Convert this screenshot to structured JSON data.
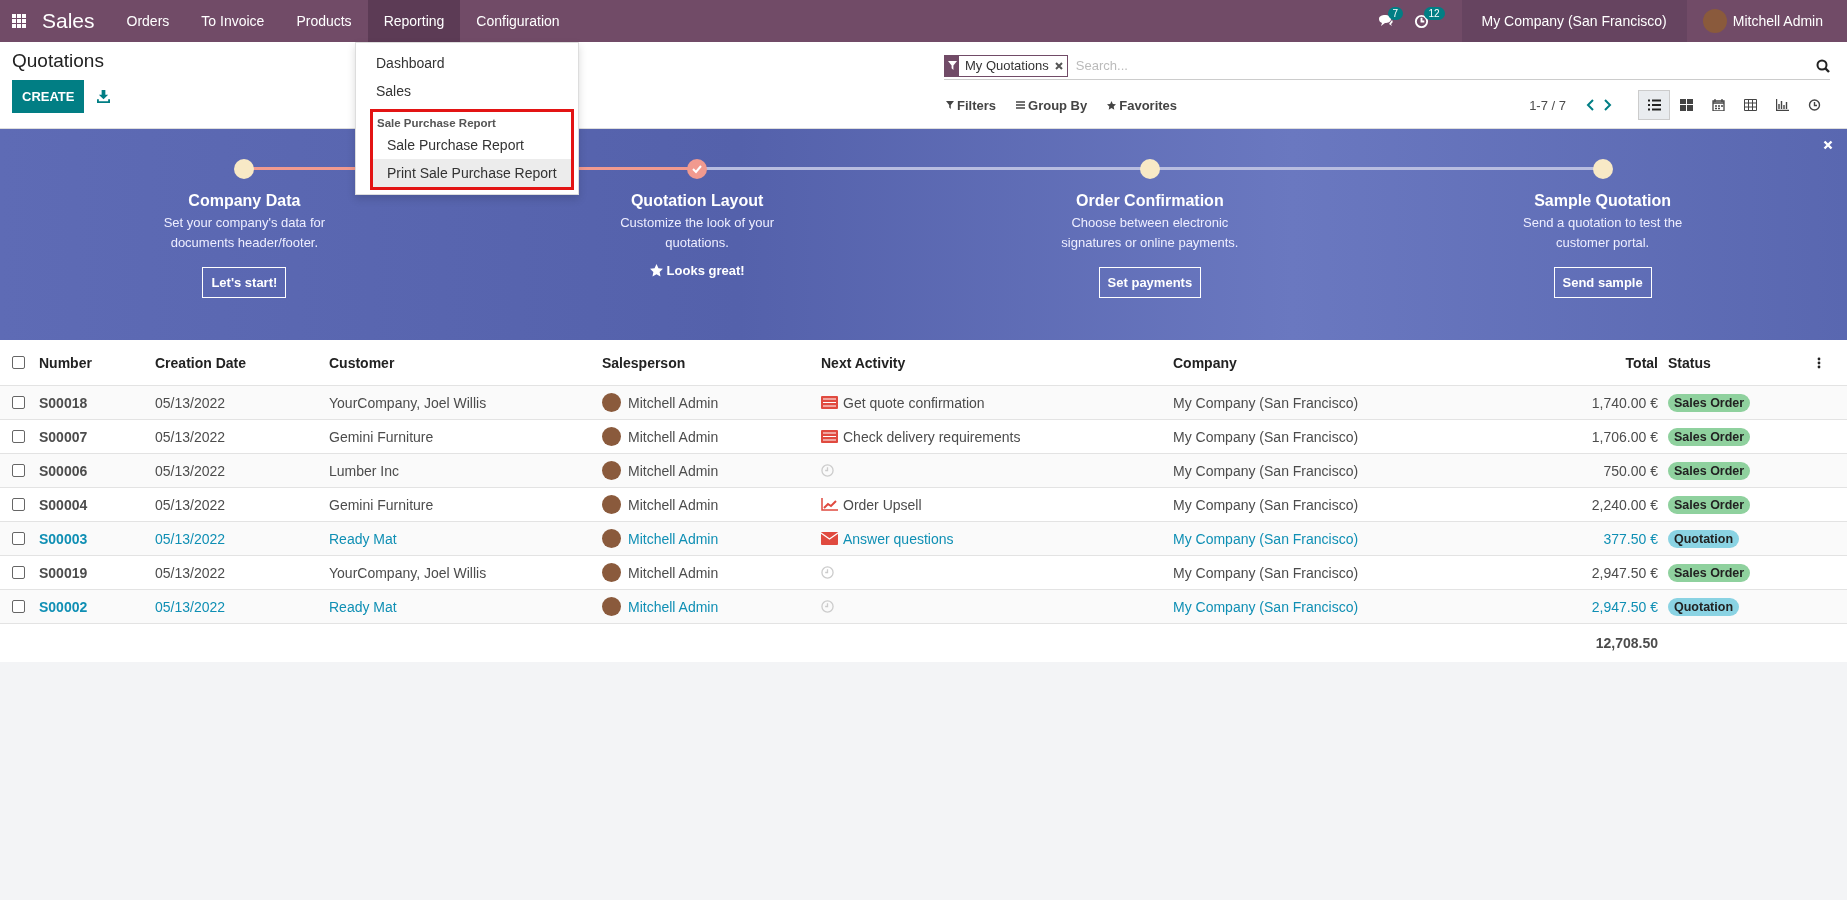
{
  "navbar": {
    "app_name": "Sales",
    "menu": [
      {
        "label": "Orders",
        "selected": false
      },
      {
        "label": "To Invoice",
        "selected": false
      },
      {
        "label": "Products",
        "selected": false
      },
      {
        "label": "Reporting",
        "selected": true
      },
      {
        "label": "Configuration",
        "selected": false
      }
    ],
    "messages_badge": "7",
    "activities_badge": "12",
    "company": "My Company (San Francisco)",
    "user": "Mitchell Admin"
  },
  "reporting_menu": {
    "items": [
      {
        "label": "Dashboard",
        "hovered": false
      },
      {
        "label": "Sales",
        "hovered": false
      }
    ],
    "groups": [
      {
        "header": "Sale Purchase Report",
        "highlighted": true,
        "items": [
          {
            "label": "Sale Purchase Report",
            "hovered": false
          },
          {
            "label": "Print Sale Purchase Report",
            "hovered": true
          }
        ]
      }
    ]
  },
  "control_panel": {
    "title": "Quotations",
    "create_button": "CREATE",
    "search": {
      "facet": "My Quotations",
      "placeholder": "Search..."
    },
    "filters": "Filters",
    "group_by": "Group By",
    "favorites": "Favorites",
    "pager": "1-7 / 7",
    "views": [
      {
        "kind": "list",
        "selected": true
      },
      {
        "kind": "kanban",
        "selected": false
      },
      {
        "kind": "calendar",
        "selected": false
      },
      {
        "kind": "pivot",
        "selected": false
      },
      {
        "kind": "graph",
        "selected": false
      },
      {
        "kind": "activity",
        "selected": false
      }
    ]
  },
  "onboarding": {
    "steps": [
      {
        "title": "Company Data",
        "description": "Set your company's data for documents header/footer.",
        "done": false,
        "action": {
          "kind": "button",
          "label": "Let's start!"
        }
      },
      {
        "title": "Quotation Layout",
        "description": "Customize the look of your quotations.",
        "done": true,
        "action": {
          "kind": "done",
          "label": "Looks great!"
        }
      },
      {
        "title": "Order Confirmation",
        "description": "Choose between electronic signatures or online payments.",
        "done": false,
        "action": {
          "kind": "button",
          "label": "Set payments"
        }
      },
      {
        "title": "Sample Quotation",
        "description": "Send a quotation to test the customer portal.",
        "done": false,
        "action": {
          "kind": "button",
          "label": "Send sample"
        }
      }
    ]
  },
  "table": {
    "columns": [
      "Number",
      "Creation Date",
      "Customer",
      "Salesperson",
      "Next Activity",
      "Company",
      "Total",
      "Status"
    ],
    "rows": [
      {
        "number": "S00018",
        "date": "05/13/2022",
        "customer": "YourCompany, Joel Willis",
        "salesperson": "Mitchell Admin",
        "activity": {
          "kind": "tasks",
          "label": "Get quote confirmation"
        },
        "company": "My Company (San Francisco)",
        "total": "1,740.00 €",
        "status": {
          "kind": "sale",
          "label": "Sales Order"
        },
        "checked": false
      },
      {
        "number": "S00007",
        "date": "05/13/2022",
        "customer": "Gemini Furniture",
        "salesperson": "Mitchell Admin",
        "activity": {
          "kind": "tasks",
          "label": "Check delivery requirements"
        },
        "company": "My Company (San Francisco)",
        "total": "1,706.00 €",
        "status": {
          "kind": "sale",
          "label": "Sales Order"
        },
        "checked": false
      },
      {
        "number": "S00006",
        "date": "05/13/2022",
        "customer": "Lumber Inc",
        "salesperson": "Mitchell Admin",
        "activity": {
          "kind": "none"
        },
        "company": "My Company (San Francisco)",
        "total": "750.00 €",
        "status": {
          "kind": "sale",
          "label": "Sales Order"
        },
        "checked": false
      },
      {
        "number": "S00004",
        "date": "05/13/2022",
        "customer": "Gemini Furniture",
        "salesperson": "Mitchell Admin",
        "activity": {
          "kind": "upsell",
          "label": "Order Upsell"
        },
        "company": "My Company (San Francisco)",
        "total": "2,240.00 €",
        "status": {
          "kind": "sale",
          "label": "Sales Order"
        },
        "checked": false
      },
      {
        "number": "S00003",
        "date": "05/13/2022",
        "customer": "Ready Mat",
        "salesperson": "Mitchell Admin",
        "activity": {
          "kind": "email",
          "label": "Answer questions"
        },
        "company": "My Company (San Francisco)",
        "total": "377.50 €",
        "status": {
          "kind": "quotation",
          "label": "Quotation"
        },
        "checked": false
      },
      {
        "number": "S00019",
        "date": "05/13/2022",
        "customer": "YourCompany, Joel Willis",
        "salesperson": "Mitchell Admin",
        "activity": {
          "kind": "none"
        },
        "company": "My Company (San Francisco)",
        "total": "2,947.50 €",
        "status": {
          "kind": "sale",
          "label": "Sales Order"
        },
        "checked": false
      },
      {
        "number": "S00002",
        "date": "05/13/2022",
        "customer": "Ready Mat",
        "salesperson": "Mitchell Admin",
        "activity": {
          "kind": "none"
        },
        "company": "My Company (San Francisco)",
        "total": "2,947.50 €",
        "status": {
          "kind": "quotation",
          "label": "Quotation"
        },
        "checked": false
      }
    ],
    "sum_total": "12,708.50",
    "all_selected": false
  }
}
